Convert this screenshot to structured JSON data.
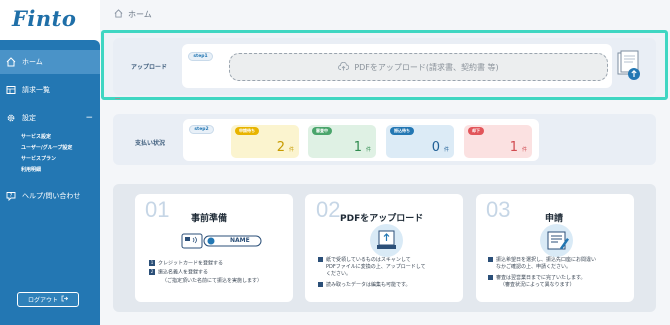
{
  "app": {
    "logo": "Finto"
  },
  "sidebar": {
    "items": [
      {
        "label": "ホーム",
        "icon": "home-icon",
        "active": true
      },
      {
        "label": "請求一覧",
        "icon": "list-icon"
      },
      {
        "label": "設定",
        "icon": "gear-icon",
        "caret": "−"
      },
      {
        "label": "ヘルプ/問い合わせ",
        "icon": "help-icon"
      }
    ],
    "sub_items": [
      "サービス設定",
      "ユーザー/グループ設定",
      "サービスプラン",
      "利用明細"
    ],
    "logout": "ログアウト"
  },
  "breadcrumb": {
    "label": "ホーム"
  },
  "upload": {
    "section_label": "アップロード",
    "step_tag": "step1",
    "dropzone_text": "PDFをアップロード(請求書、契約書 等)"
  },
  "payment": {
    "section_label": "支払い状況",
    "step_tag": "step2",
    "statuses": [
      {
        "label": "申請待ち",
        "count": "2",
        "unit": "件",
        "pill_color": "#e8b400",
        "bg": "#fbf4cf",
        "num_color": "#c79a00"
      },
      {
        "label": "審査中",
        "count": "1",
        "unit": "件",
        "pill_color": "#4aa56b",
        "bg": "#dff1e4",
        "num_color": "#2f8b4e"
      },
      {
        "label": "振込待ち",
        "count": "0",
        "unit": "件",
        "pill_color": "#2377b3",
        "bg": "#dcebf6",
        "num_color": "#1f5f95"
      },
      {
        "label": "却下",
        "count": "1",
        "unit": "件",
        "pill_color": "#e2555a",
        "bg": "#fbe1e1",
        "num_color": "#d14a50"
      }
    ]
  },
  "steps": [
    {
      "num": "01",
      "title": "事前準備",
      "card_label": "NAME",
      "lines": [
        {
          "marker": "1",
          "text": "クレジットカードを登録する"
        },
        {
          "marker": "2",
          "text": "振込名義人を登録する"
        },
        {
          "marker": "",
          "text": "（ご指定頂いた名前にて振込を実施します）"
        }
      ]
    },
    {
      "num": "02",
      "title": "PDFをアップロード",
      "lines": [
        {
          "marker": "■",
          "text": "紙で受領しているものはスキャンして"
        },
        {
          "marker": "",
          "text": "PDFファイルに変換の上、アップロードして"
        },
        {
          "marker": "",
          "text": "ください。"
        },
        {
          "marker": "■",
          "text": "読み取ったデータは編集も可能です。"
        }
      ]
    },
    {
      "num": "03",
      "title": "申請",
      "lines": [
        {
          "marker": "■",
          "text": "振込希望日を選択し、振込先口座にお間違い"
        },
        {
          "marker": "",
          "text": "なかご確認の上、申請ください。"
        },
        {
          "marker": "■",
          "text": "審査は翌営業日までに完了いたします。"
        },
        {
          "marker": "",
          "text": "（審査状況によって異なります）"
        }
      ]
    }
  ],
  "colors": {
    "sidebar": "#2377b3",
    "highlight": "#3fd6c2",
    "accent": "#2377b3"
  }
}
